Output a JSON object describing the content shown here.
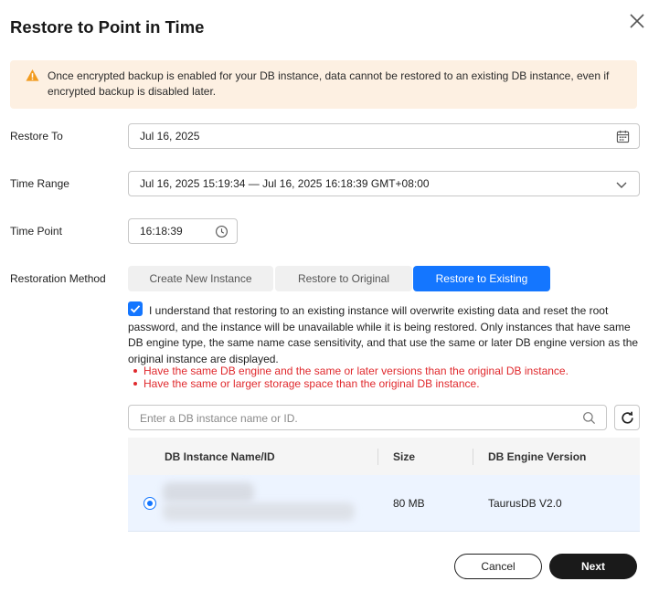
{
  "dialog": {
    "title": "Restore to Point in Time",
    "close_icon": "close-icon"
  },
  "warning": {
    "icon": "warning-triangle-icon",
    "text": "Once encrypted backup is enabled for your DB instance, data cannot be restored to an existing DB instance, even if encrypted backup is disabled later."
  },
  "form": {
    "restore_to": {
      "label": "Restore To",
      "value": "Jul 16, 2025",
      "icon": "calendar-icon"
    },
    "time_range": {
      "label": "Time Range",
      "value": "Jul 16, 2025 15:19:34 — Jul 16, 2025 16:18:39 GMT+08:00",
      "icon": "chevron-down-icon"
    },
    "time_point": {
      "label": "Time Point",
      "value": "16:18:39",
      "icon": "clock-icon"
    },
    "restoration_method": {
      "label": "Restoration Method",
      "options": [
        "Create New Instance",
        "Restore to Original",
        "Restore to Existing"
      ],
      "selected": "Restore to Existing"
    }
  },
  "agreement": {
    "checked": true,
    "text": "I understand that restoring to an existing instance will overwrite existing data and reset the root password, and the instance will be unavailable while it is being restored. Only instances that have same DB engine type, the same name case sensitivity, and that use the same or later DB engine version as the original instance are displayed.",
    "requirements": [
      "Have the same DB engine and the same or later versions than the original DB instance.",
      "Have the same or larger storage space than the original DB instance."
    ]
  },
  "search": {
    "placeholder": "Enter a DB instance name or ID.",
    "icon": "search-icon",
    "refresh_icon": "refresh-icon"
  },
  "table": {
    "columns": [
      "DB Instance Name/ID",
      "Size",
      "DB Engine Version"
    ],
    "rows": [
      {
        "selected": true,
        "size": "80 MB",
        "engine_version": "TaurusDB V2.0"
      }
    ]
  },
  "footer": {
    "cancel_label": "Cancel",
    "next_label": "Next"
  },
  "colors": {
    "accent": "#1476ff",
    "warning_bg": "#fdf0e2",
    "warning_icon": "#f29b1f",
    "error": "#e0292d"
  }
}
